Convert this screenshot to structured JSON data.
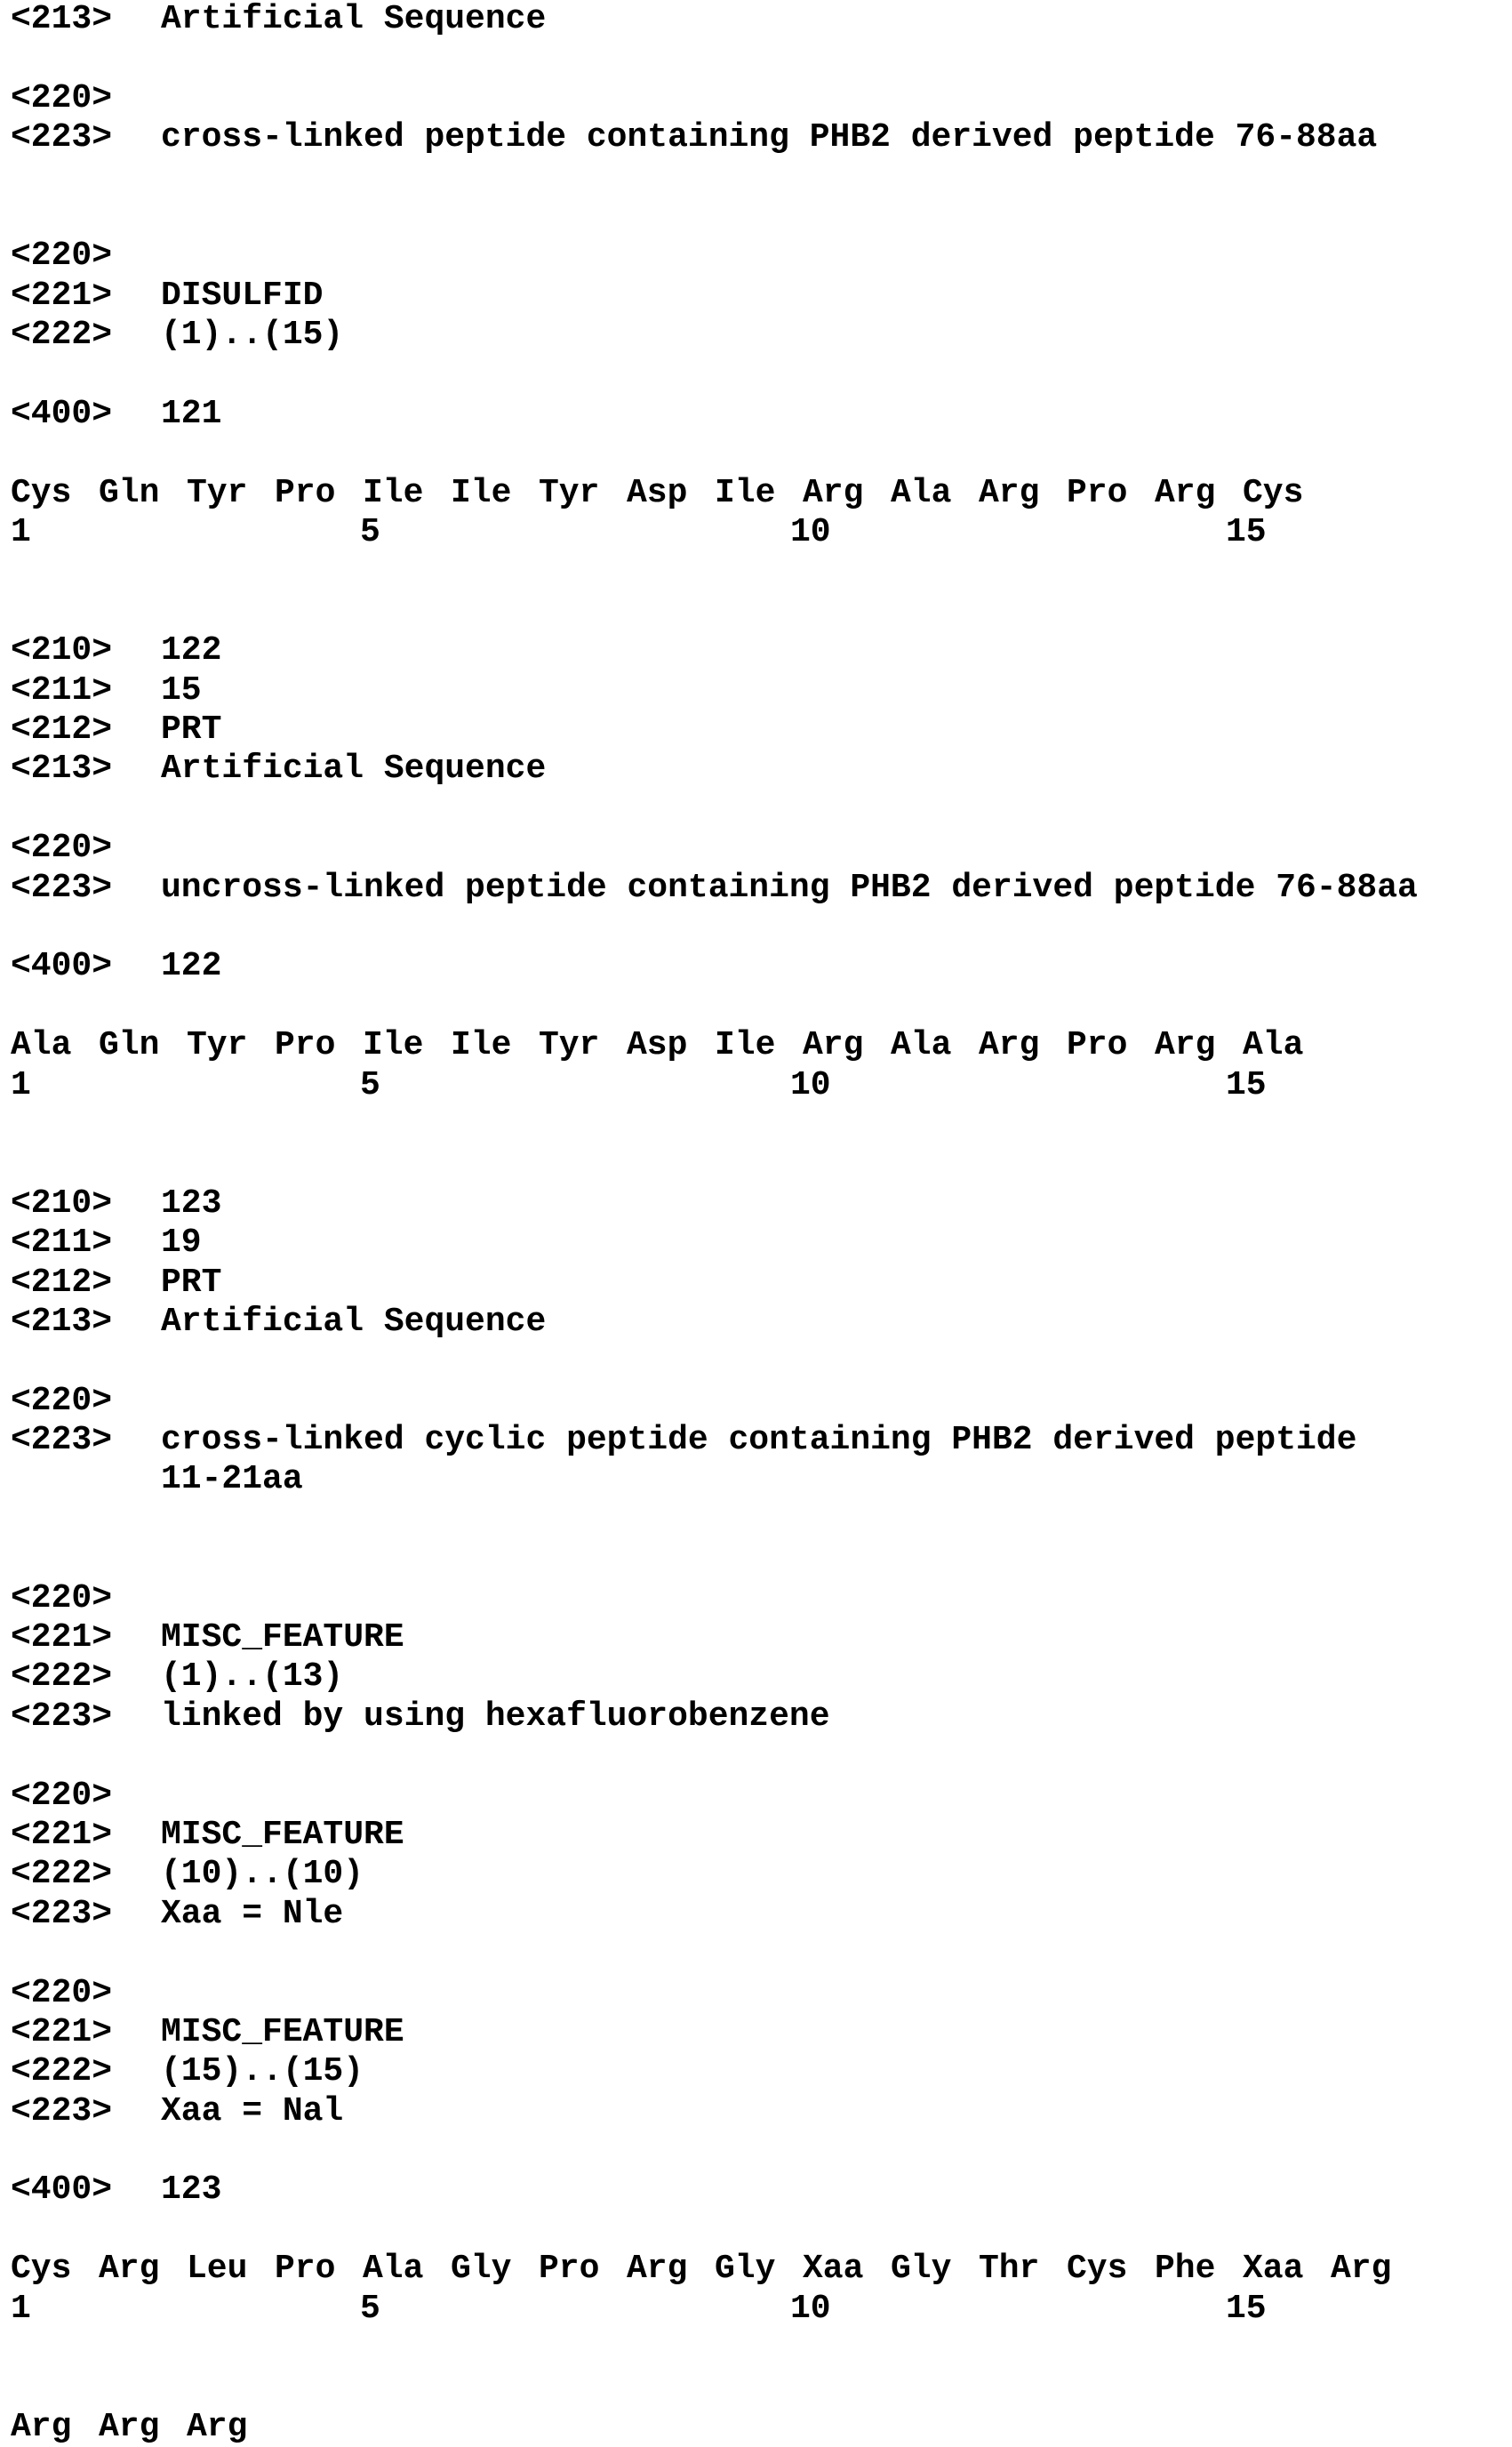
{
  "lines": [
    {
      "tag": "<213>",
      "value": "Artificial Sequence"
    },
    {
      "blank": true
    },
    {
      "tag": "<220>",
      "value": ""
    },
    {
      "tag": "<223>",
      "value": "cross-linked peptide containing PHB2 derived peptide 76-88aa"
    },
    {
      "blank": true
    },
    {
      "blank": true
    },
    {
      "tag": "<220>",
      "value": ""
    },
    {
      "tag": "<221>",
      "value": "DISULFID"
    },
    {
      "tag": "<222>",
      "value": "(1)..(15)"
    },
    {
      "blank": true
    },
    {
      "tag": "<400>",
      "value": "121"
    },
    {
      "blank": true
    },
    {
      "sequence": [
        "Cys",
        "Gln",
        "Tyr",
        "Pro",
        "Ile",
        "Ile",
        "Tyr",
        "Asp",
        "Ile",
        "Arg",
        "Ala",
        "Arg",
        "Pro",
        "Arg",
        "Cys"
      ]
    },
    {
      "numbering": [
        "1",
        "5",
        "10",
        "15"
      ]
    },
    {
      "blank": true
    },
    {
      "blank": true
    },
    {
      "tag": "<210>",
      "value": "122"
    },
    {
      "tag": "<211>",
      "value": "15"
    },
    {
      "tag": "<212>",
      "value": "PRT"
    },
    {
      "tag": "<213>",
      "value": "Artificial Sequence"
    },
    {
      "blank": true
    },
    {
      "tag": "<220>",
      "value": ""
    },
    {
      "tag": "<223>",
      "value": "uncross-linked peptide containing PHB2 derived peptide 76-88aa"
    },
    {
      "blank": true
    },
    {
      "tag": "<400>",
      "value": "122"
    },
    {
      "blank": true
    },
    {
      "sequence": [
        "Ala",
        "Gln",
        "Tyr",
        "Pro",
        "Ile",
        "Ile",
        "Tyr",
        "Asp",
        "Ile",
        "Arg",
        "Ala",
        "Arg",
        "Pro",
        "Arg",
        "Ala"
      ]
    },
    {
      "numbering": [
        "1",
        "5",
        "10",
        "15"
      ]
    },
    {
      "blank": true
    },
    {
      "blank": true
    },
    {
      "tag": "<210>",
      "value": "123"
    },
    {
      "tag": "<211>",
      "value": "19"
    },
    {
      "tag": "<212>",
      "value": "PRT"
    },
    {
      "tag": "<213>",
      "value": "Artificial Sequence"
    },
    {
      "blank": true
    },
    {
      "tag": "<220>",
      "value": ""
    },
    {
      "tag": "<223>",
      "value": "cross-linked cyclic peptide containing PHB2 derived peptide"
    },
    {
      "continuation": "11-21aa"
    },
    {
      "blank": true
    },
    {
      "blank": true
    },
    {
      "tag": "<220>",
      "value": ""
    },
    {
      "tag": "<221>",
      "value": "MISC_FEATURE"
    },
    {
      "tag": "<222>",
      "value": "(1)..(13)"
    },
    {
      "tag": "<223>",
      "value": "linked by using hexafluorobenzene"
    },
    {
      "blank": true
    },
    {
      "tag": "<220>",
      "value": ""
    },
    {
      "tag": "<221>",
      "value": "MISC_FEATURE"
    },
    {
      "tag": "<222>",
      "value": "(10)..(10)"
    },
    {
      "tag": "<223>",
      "value": "Xaa = Nle"
    },
    {
      "blank": true
    },
    {
      "tag": "<220>",
      "value": ""
    },
    {
      "tag": "<221>",
      "value": "MISC_FEATURE"
    },
    {
      "tag": "<222>",
      "value": "(15)..(15)"
    },
    {
      "tag": "<223>",
      "value": "Xaa = Nal"
    },
    {
      "blank": true
    },
    {
      "tag": "<400>",
      "value": "123"
    },
    {
      "blank": true
    },
    {
      "sequence": [
        "Cys",
        "Arg",
        "Leu",
        "Pro",
        "Ala",
        "Gly",
        "Pro",
        "Arg",
        "Gly",
        "Xaa",
        "Gly",
        "Thr",
        "Cys",
        "Phe",
        "Xaa",
        "Arg"
      ]
    },
    {
      "numbering": [
        "1",
        "5",
        "10",
        "15"
      ]
    },
    {
      "blank": true
    },
    {
      "blank": true
    },
    {
      "sequence": [
        "Arg",
        "Arg",
        "Arg"
      ]
    }
  ]
}
